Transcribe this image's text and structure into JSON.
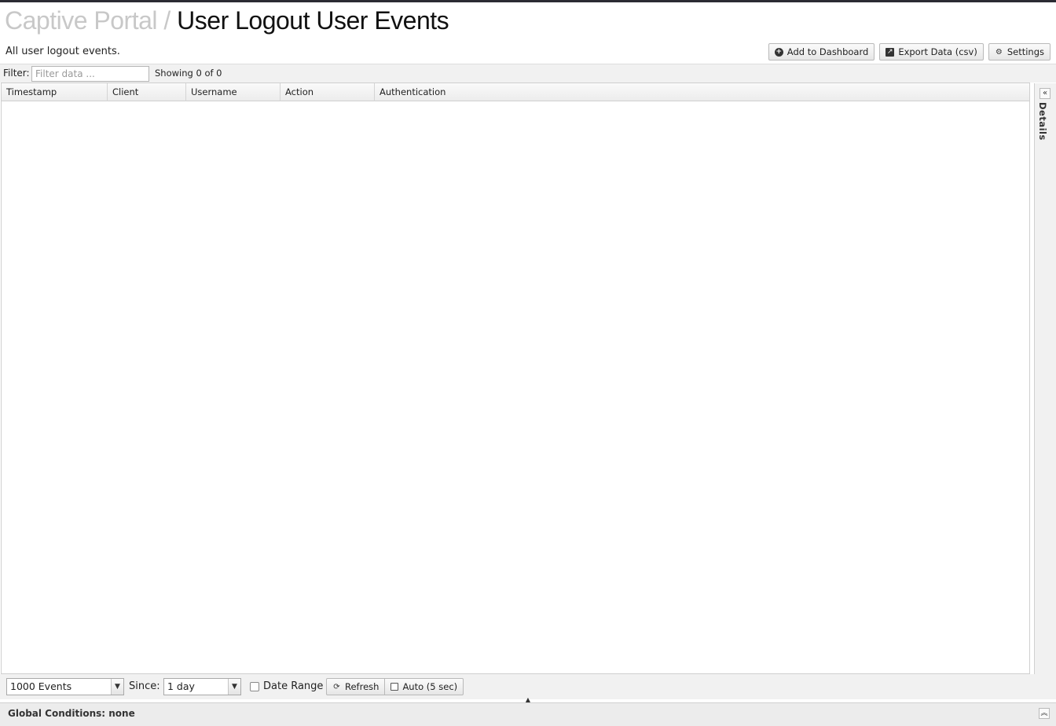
{
  "header": {
    "crumb": "Captive Portal",
    "separator": "/",
    "title": "User Logout User Events",
    "description": "All user logout events."
  },
  "toolbar": {
    "add_dashboard_label": "Add to Dashboard",
    "export_label": "Export Data (csv)",
    "settings_label": "Settings"
  },
  "filter": {
    "label": "Filter:",
    "placeholder": "Filter data ...",
    "value": "",
    "showing": "Showing 0 of 0"
  },
  "grid": {
    "columns": [
      "Timestamp",
      "Client",
      "Username",
      "Action",
      "Authentication"
    ],
    "rows": []
  },
  "details_panel": {
    "label": "Details"
  },
  "bottom": {
    "events_select": "1000 Events",
    "since_label": "Since:",
    "since_select": "1 day",
    "date_range_label": "Date Range",
    "date_range_checked": false,
    "refresh_label": "Refresh",
    "auto_label": "Auto (5 sec)",
    "auto_checked": false
  },
  "global": {
    "conditions_text": "Global Conditions: none"
  },
  "icons": {
    "add": "plus-circle-icon",
    "export": "export-icon",
    "settings": "gear-icon",
    "refresh": "refresh-icon",
    "collapse": "double-chevron-left-icon",
    "expand": "double-chevron-up-icon"
  }
}
